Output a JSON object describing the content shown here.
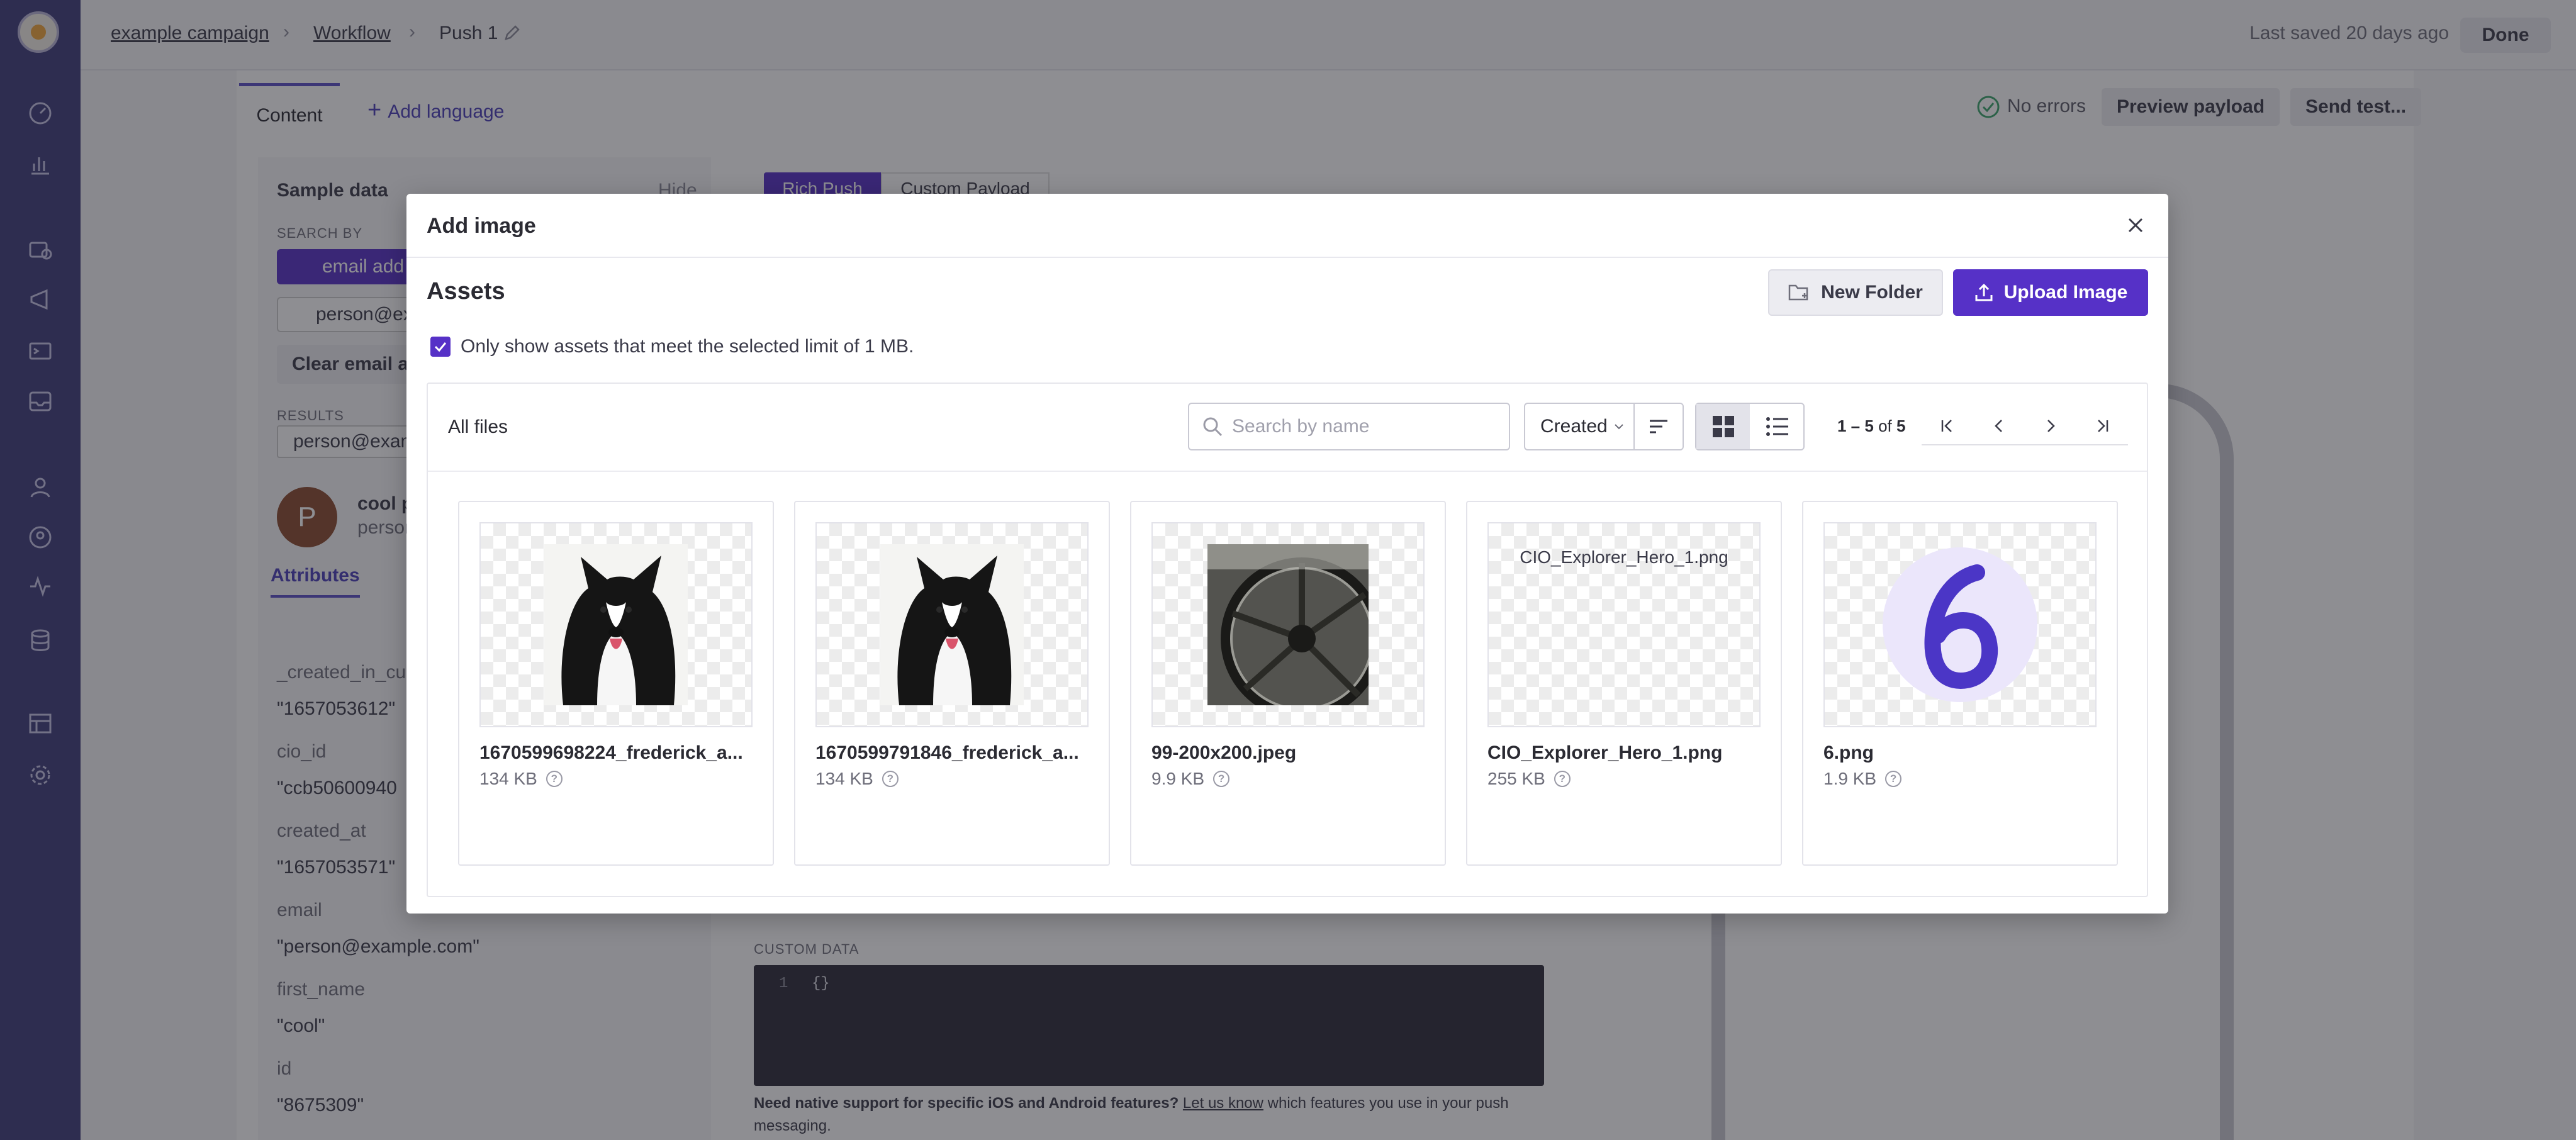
{
  "breadcrumb": {
    "campaign": "example campaign",
    "workflow": "Workflow",
    "current": "Push 1"
  },
  "header": {
    "last_saved": "Last saved 20 days ago",
    "done_label": "Done"
  },
  "editor": {
    "tab_content": "Content",
    "add_language": "Add language",
    "no_errors": "No errors",
    "preview_payload": "Preview payload",
    "send_test": "Send test...",
    "push_tabs": [
      "Rich Push",
      "Custom Payload"
    ],
    "custom_data_label": "CUSTOM DATA",
    "custom_data_value": "{}",
    "native_support_strong": "Need native support for specific iOS and Android features?",
    "native_support_link": "Let us know",
    "native_support_rest": "which features you use in your push messaging."
  },
  "sample_panel": {
    "title": "Sample data",
    "hide": "Hide",
    "search_by_label": "SEARCH BY",
    "search_by_value": "email add",
    "search_value": "person@ex",
    "clear_button": "Clear email a",
    "results_label": "RESULTS",
    "result_value": "person@exam",
    "avatar_letter": "P",
    "profile_name": "cool p",
    "profile_email": "persor",
    "attributes_tab": "Attributes",
    "attributes": [
      {
        "key": "_created_in_cus",
        "value": "\"1657053612\""
      },
      {
        "key": "cio_id",
        "value": "\"ccb50600940"
      },
      {
        "key": "created_at",
        "value": "\"1657053571\""
      },
      {
        "key": "email",
        "value": "\"person@example.com\""
      },
      {
        "key": "first_name",
        "value": "\"cool\""
      },
      {
        "key": "id",
        "value": "\"8675309\""
      }
    ]
  },
  "modal": {
    "title": "Add image",
    "section_title": "Assets",
    "new_folder_label": "New Folder",
    "upload_label": "Upload Image",
    "limit_checked": true,
    "limit_label": "Only show assets that meet the selected limit of 1 MB.",
    "all_files_label": "All files",
    "search_placeholder": "Search by name",
    "sort_value": "Created",
    "pagination": {
      "range": "1 – 5",
      "of": "of",
      "total": "5"
    },
    "view_mode": "grid",
    "assets": [
      {
        "name": "1670599698224_frederick_a...",
        "size": "134 KB",
        "kind": "dog-photo"
      },
      {
        "name": "1670599791846_frederick_a...",
        "size": "134 KB",
        "kind": "dog-photo"
      },
      {
        "name": "99-200x200.jpeg",
        "size": "9.9 KB",
        "kind": "wheel-photo"
      },
      {
        "name": "CIO_Explorer_Hero_1.png",
        "size": "255 KB",
        "kind": "broken-image",
        "alt": "CIO_Explorer_Hero_1.png"
      },
      {
        "name": "6.png",
        "size": "1.9 KB",
        "kind": "number-six"
      }
    ]
  },
  "colors": {
    "accent": "#5631c7",
    "nav_bg": "#3f3d7a",
    "overlay": "rgba(30,30,38,0.5)"
  }
}
